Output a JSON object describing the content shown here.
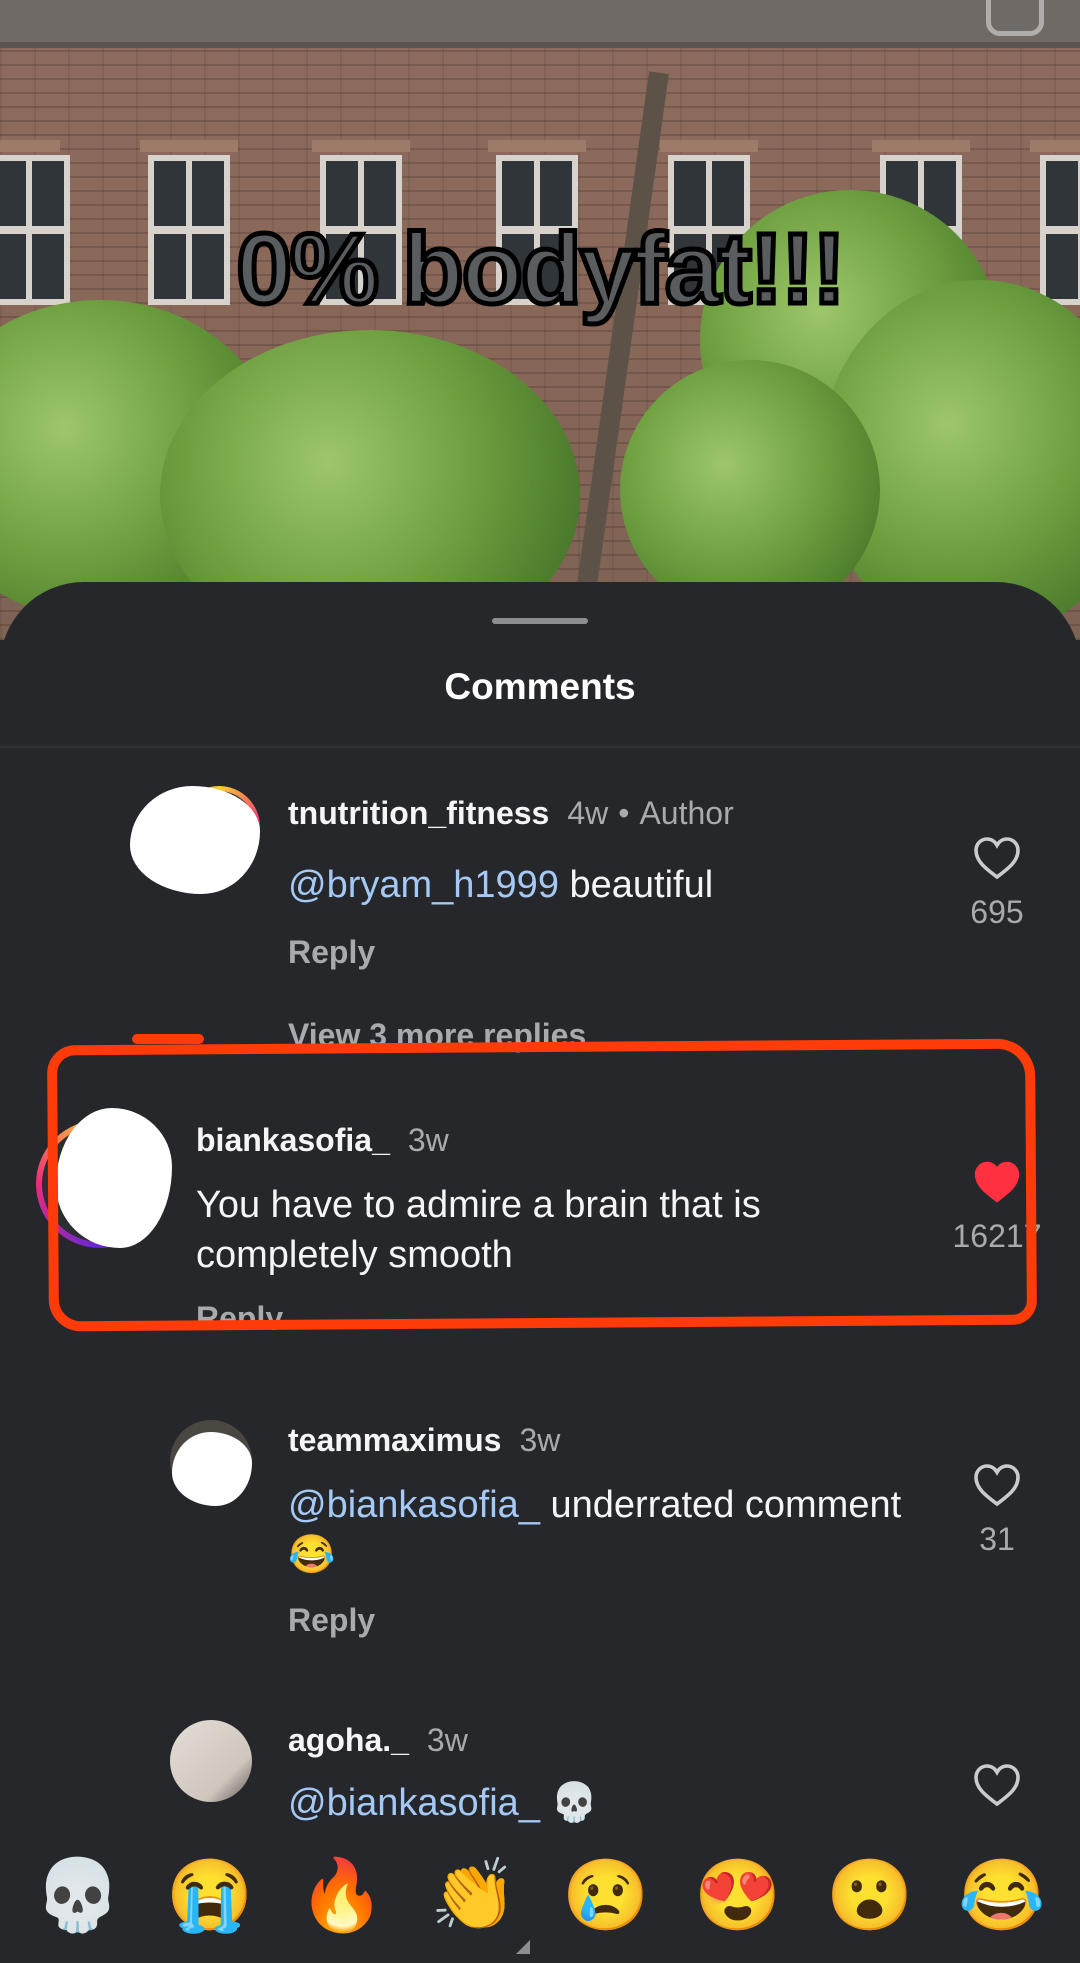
{
  "video": {
    "overlay_text": "0% bodyfat!!!"
  },
  "sheet": {
    "title": "Comments"
  },
  "comments": [
    {
      "username": "tnutrition_fitness",
      "time": "4w",
      "author_tag": "Author",
      "mention": "@bryam_h1999",
      "text": " beautiful",
      "reply_label": "Reply",
      "like_count": "695",
      "liked": false
    },
    {
      "username": "biankasofia_",
      "time": "3w",
      "text": "You have to admire a brain that is completely smooth",
      "reply_label": "Reply",
      "like_count": "16217",
      "liked": true
    },
    {
      "username": "teammaximus",
      "time": "3w",
      "mention": "@biankasofia_",
      "text": " underrated comment 😂",
      "reply_label": "Reply",
      "like_count": "31",
      "liked": false
    },
    {
      "username": "agoha._",
      "time": "3w",
      "mention": "@biankasofia_",
      "text": " 💀",
      "liked": false
    }
  ],
  "view_more_label": "View 3 more replies",
  "emoji_bar": [
    "💀",
    "😭",
    "🔥",
    "👏",
    "😢",
    "😍",
    "😮",
    "😂"
  ],
  "colors": {
    "sheet_bg": "#25272b",
    "mention": "#a5c9f5",
    "liked_heart": "#ff3040",
    "highlight_annotation": "#ff3b0a"
  }
}
